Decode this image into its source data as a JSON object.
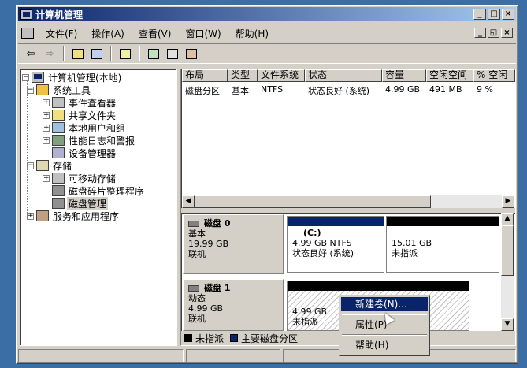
{
  "window": {
    "title": "计算机管理"
  },
  "menu": {
    "items": [
      {
        "label": "文件(F)"
      },
      {
        "label": "操作(A)"
      },
      {
        "label": "查看(V)"
      },
      {
        "label": "窗口(W)"
      },
      {
        "label": "帮助(H)"
      }
    ]
  },
  "toolbar": {
    "back": "⇦",
    "forward": "⇨"
  },
  "tree": {
    "root": "计算机管理(本地)",
    "system_tools": "系统工具",
    "event_viewer": "事件查看器",
    "shared_folders": "共享文件夹",
    "local_users": "本地用户和组",
    "perf_logs": "性能日志和警报",
    "device_manager": "设备管理器",
    "storage": "存储",
    "removable": "可移动存储",
    "defrag": "磁盘碎片整理程序",
    "disk_mgmt": "磁盘管理",
    "services": "服务和应用程序"
  },
  "volume_list": {
    "columns": [
      "布局",
      "类型",
      "文件系统",
      "状态",
      "容量",
      "空闲空间",
      "% 空闲"
    ],
    "rows": [
      [
        "磁盘分区",
        "基本",
        "NTFS",
        "状态良好 (系统)",
        "4.99 GB",
        "491 MB",
        "9 %"
      ]
    ]
  },
  "disks": [
    {
      "name": "磁盘 0",
      "type": "基本",
      "size": "19.99 GB",
      "status": "联机",
      "partitions": [
        {
          "label": "(C:)",
          "line1": "4.99 GB NTFS",
          "line2": "状态良好 (系统)",
          "color": "#0a246a"
        },
        {
          "label": "",
          "line1": "15.01 GB",
          "line2": "未指派",
          "color": "#000000"
        }
      ]
    },
    {
      "name": "磁盘 1",
      "type": "动态",
      "size": "4.99 GB",
      "status": "联机",
      "partitions": [
        {
          "label": "",
          "line1": "4.99 GB",
          "line2": "未指派",
          "color": "#000000"
        }
      ]
    }
  ],
  "legend": {
    "unallocated": "未指派",
    "primary": "主要磁盘分区"
  },
  "context_menu": {
    "items": [
      "新建卷(N)...",
      "属性(P)",
      "帮助(H)"
    ]
  },
  "colors": {
    "title_start": "#0a246a",
    "title_end": "#a6caf0",
    "desktop": "#3a6ea5",
    "primary_partition": "#0a246a"
  }
}
